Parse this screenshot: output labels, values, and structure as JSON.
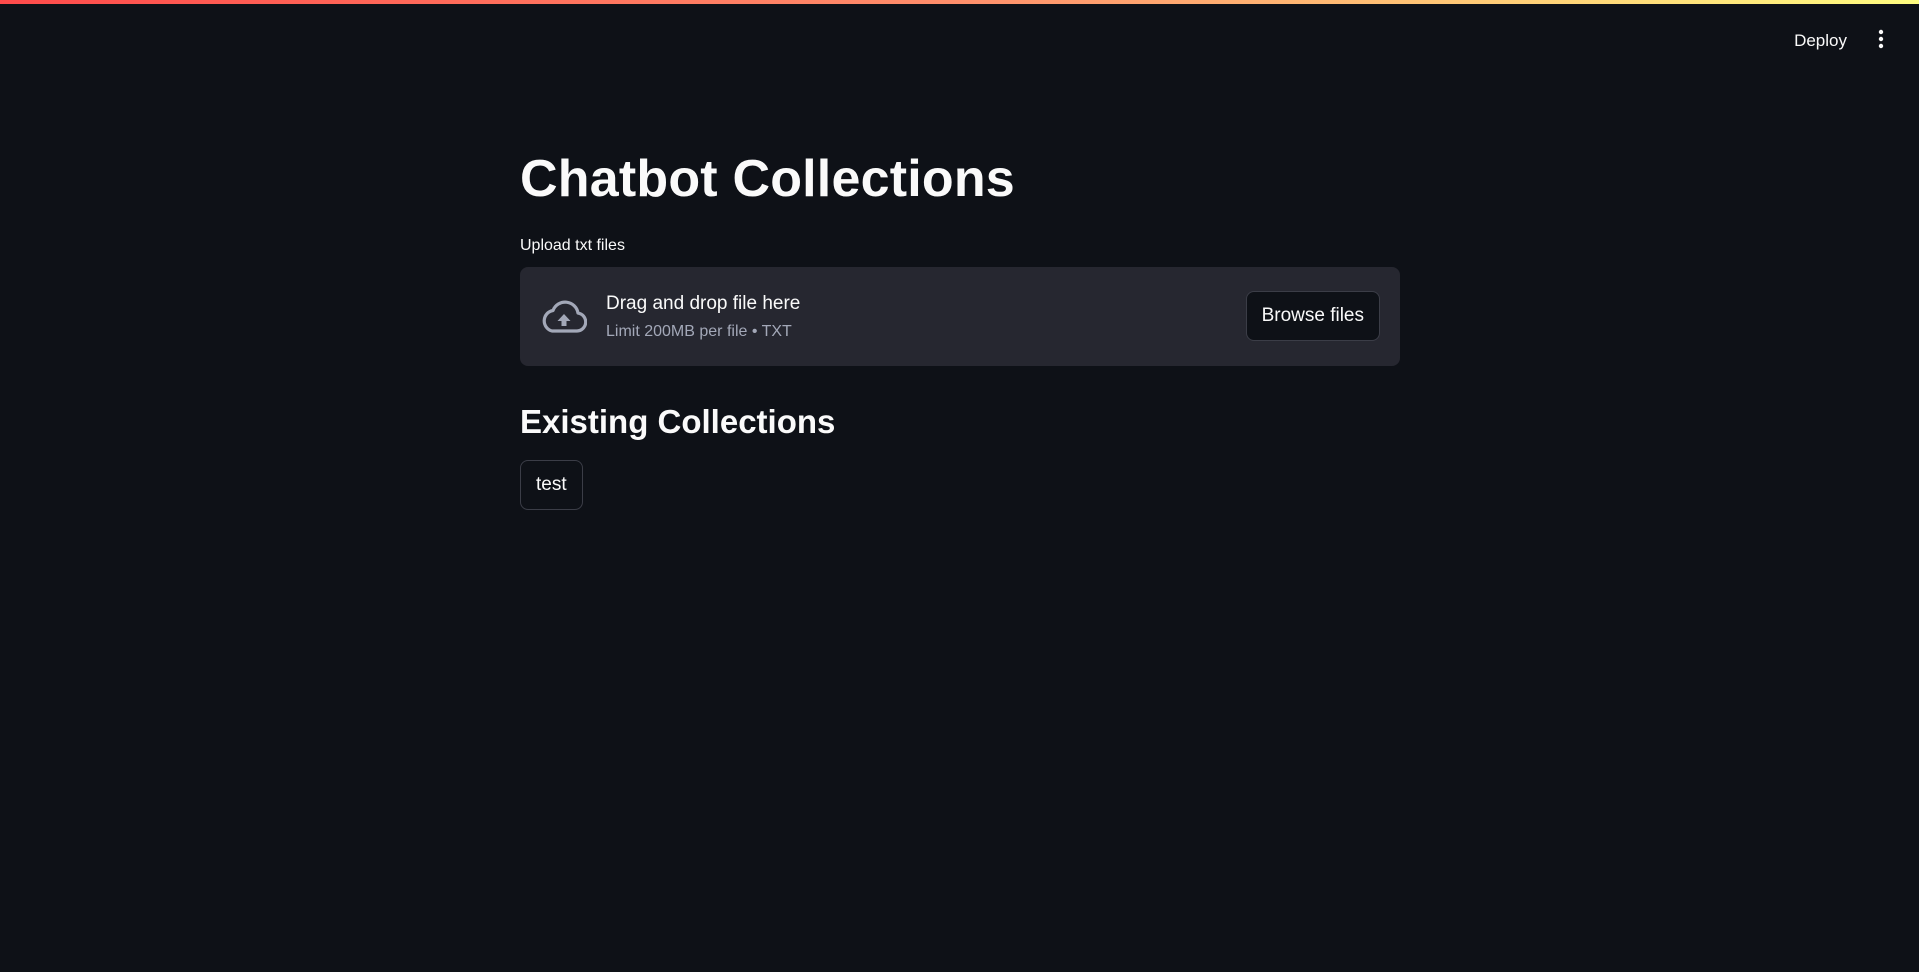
{
  "header": {
    "deploy_label": "Deploy",
    "menu_icon": "vertical-ellipsis-icon"
  },
  "main": {
    "title": "Chatbot Collections",
    "uploader": {
      "label": "Upload txt files",
      "drop_text": "Drag and drop file here",
      "limit_text": "Limit 200MB per file • TXT",
      "browse_label": "Browse files",
      "icon": "cloud-upload-icon"
    },
    "collections": {
      "heading": "Existing Collections",
      "items": [
        "test"
      ]
    }
  },
  "colors": {
    "background": "#0e1117",
    "dropzone": "#262730",
    "text": "#fafafa",
    "muted_text": "#a3a8b8",
    "decoration_gradient": [
      "#ff4b4b",
      "#fffd80"
    ]
  }
}
